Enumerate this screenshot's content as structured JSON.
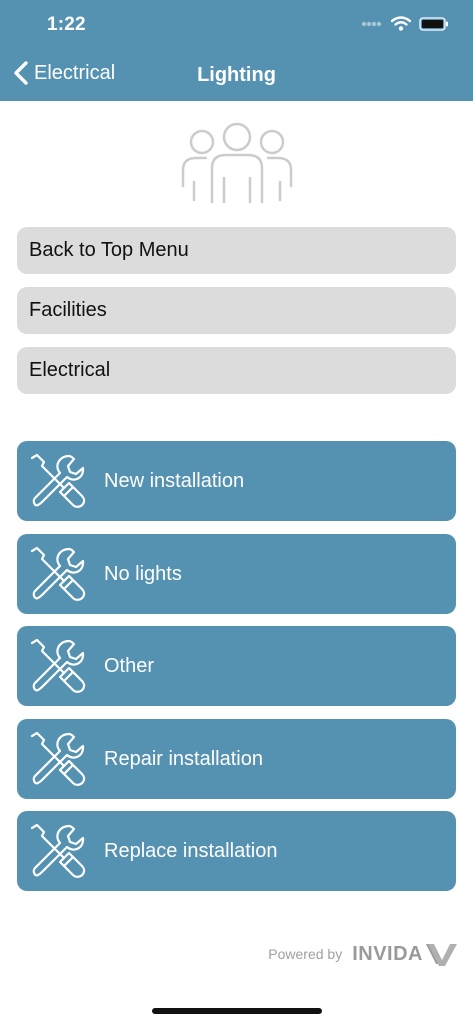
{
  "status_bar": {
    "time": "1:22",
    "icons": [
      "signal-dots-icon",
      "wifi-icon",
      "battery-icon"
    ]
  },
  "nav": {
    "back_label": "Electrical",
    "title": "Lighting"
  },
  "breadcrumbs": [
    {
      "label": "Back to Top Menu"
    },
    {
      "label": "Facilities"
    },
    {
      "label": "Electrical"
    }
  ],
  "actions": [
    {
      "label": "New installation",
      "icon": "tools-icon"
    },
    {
      "label": "No lights",
      "icon": "tools-icon"
    },
    {
      "label": "Other",
      "icon": "tools-icon"
    },
    {
      "label": "Repair installation",
      "icon": "tools-icon"
    },
    {
      "label": "Replace installation",
      "icon": "tools-icon"
    }
  ],
  "footer": {
    "powered_by": "Powered by",
    "brand": "INVIDA"
  },
  "colors": {
    "primary": "#5592b2",
    "crumb_bg": "#dcdcdc",
    "text_light": "#ffffff",
    "text_dark": "#111111"
  }
}
